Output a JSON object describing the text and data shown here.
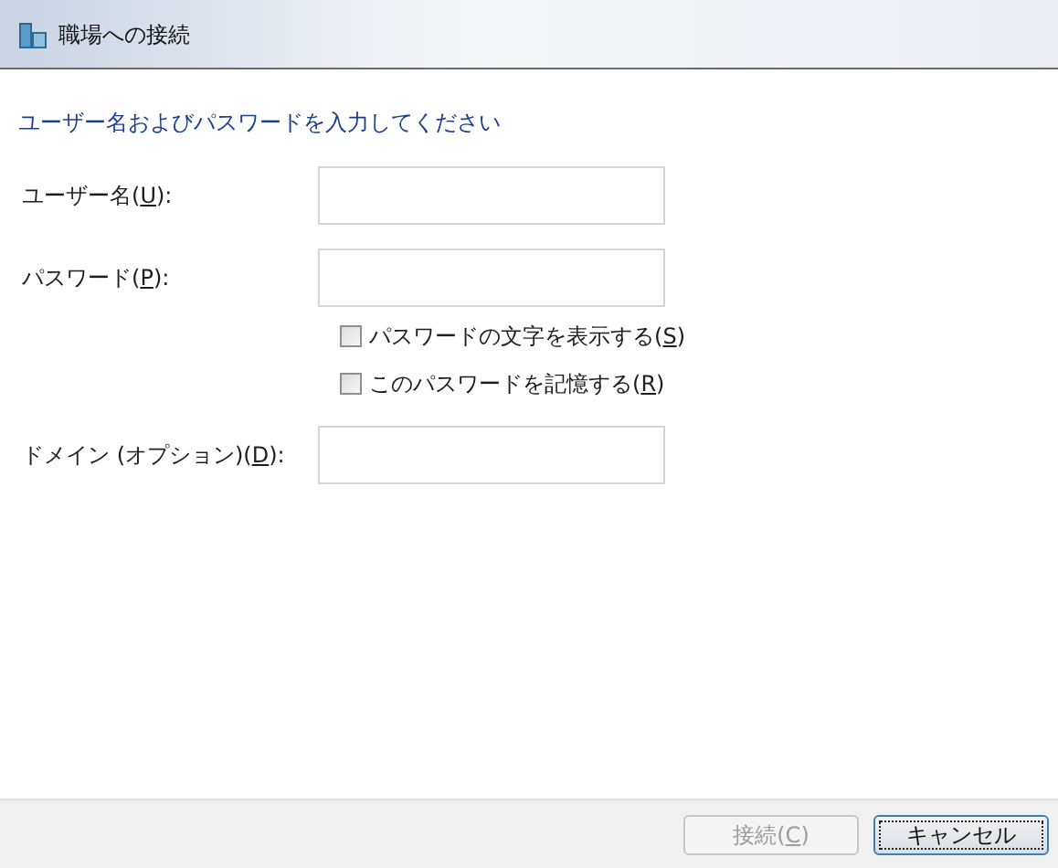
{
  "window": {
    "title": "職場への接続"
  },
  "heading": "ユーザー名およびパスワードを入力してください",
  "fields": [
    {
      "kind": "field",
      "before": "ユーザー名(",
      "key": "U",
      "after": "):"
    },
    {
      "kind": "field",
      "before": "パスワード(",
      "key": "P",
      "after": "):"
    },
    {
      "kind": "checkbox",
      "before": "パスワードの文字を表示する(",
      "key": "S",
      "after": ")",
      "checked": false
    },
    {
      "kind": "checkbox",
      "before": "このパスワードを記憶する(",
      "key": "R",
      "after": ")",
      "checked": false
    },
    {
      "kind": "field",
      "before": "ドメイン (オプション)(",
      "key": "D",
      "after": "):"
    }
  ],
  "buttons": [
    {
      "before": "接続(",
      "key": "C",
      "after": ")",
      "disabled": true,
      "default": false
    },
    {
      "before": "キャンセル",
      "disabled": false,
      "default": true
    }
  ]
}
